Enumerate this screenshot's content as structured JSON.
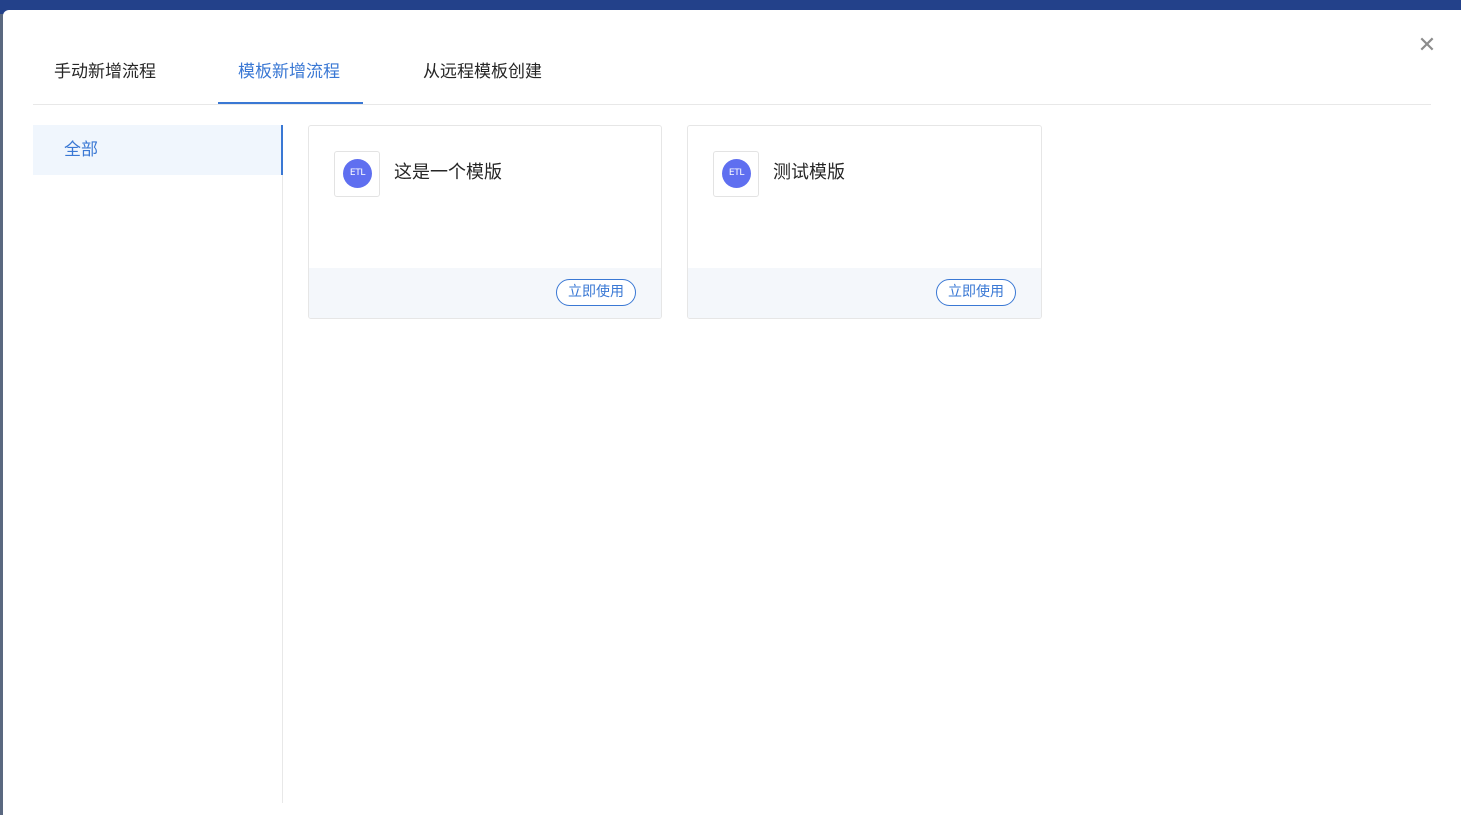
{
  "tabs": [
    {
      "label": "手动新增流程",
      "active": false
    },
    {
      "label": "模板新增流程",
      "active": true
    },
    {
      "label": "从远程模板创建",
      "active": false
    }
  ],
  "close_icon": "close-icon",
  "sidebar": {
    "items": [
      {
        "label": "全部",
        "active": true
      }
    ]
  },
  "templates": [
    {
      "icon_text": "ETL",
      "title": "这是一个模版",
      "action_label": "立即使用"
    },
    {
      "icon_text": "ETL",
      "title": "测试模版",
      "action_label": "立即使用"
    }
  ],
  "colors": {
    "accent": "#3a78d4",
    "header_bar": "#23418a",
    "icon_circle": "#5f6ff0",
    "card_footer": "#f4f7fb",
    "sidebar_active_bg": "#f0f6fd"
  }
}
